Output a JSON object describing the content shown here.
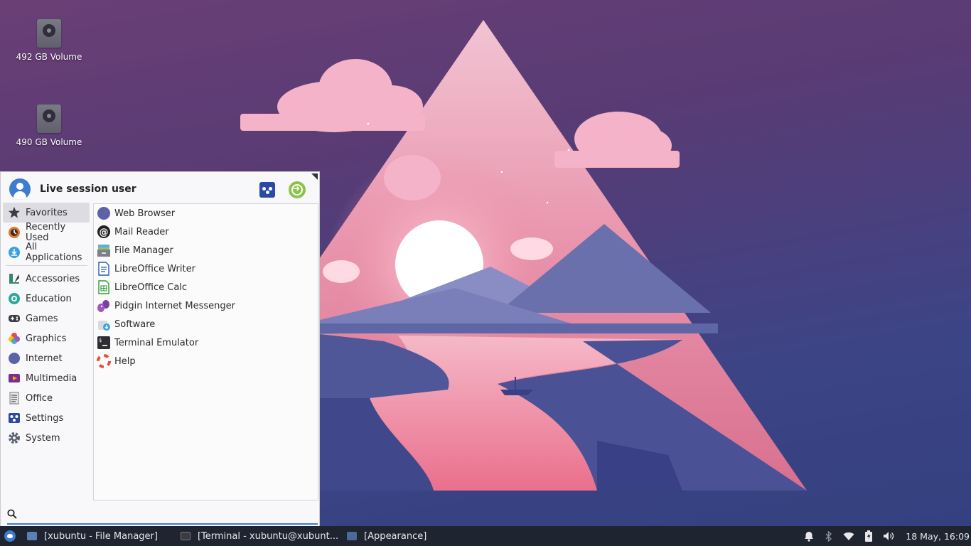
{
  "desktop": {
    "icons": [
      {
        "label": "492 GB Volume",
        "icon": "drive-icon"
      },
      {
        "label": "490 GB Volume",
        "icon": "drive-icon"
      }
    ]
  },
  "menu": {
    "user_name": "Live session user",
    "header_buttons": {
      "settings": "settings-icon",
      "logout": "logout-icon"
    },
    "categories": [
      {
        "label": "Favorites",
        "icon": "star-icon",
        "active": true
      },
      {
        "label": "Recently Used",
        "icon": "clock-icon"
      },
      {
        "label": "All Applications",
        "icon": "download-icon"
      },
      {
        "label": "Accessories",
        "icon": "accessories-icon"
      },
      {
        "label": "Education",
        "icon": "education-icon"
      },
      {
        "label": "Games",
        "icon": "gamepad-icon"
      },
      {
        "label": "Graphics",
        "icon": "graphics-icon"
      },
      {
        "label": "Internet",
        "icon": "globe-icon"
      },
      {
        "label": "Multimedia",
        "icon": "multimedia-icon"
      },
      {
        "label": "Office",
        "icon": "office-icon"
      },
      {
        "label": "Settings",
        "icon": "settings-icon"
      },
      {
        "label": "System",
        "icon": "gear-icon"
      }
    ],
    "apps": [
      {
        "label": "Web Browser",
        "icon": "compass-icon"
      },
      {
        "label": "Mail Reader",
        "icon": "at-icon"
      },
      {
        "label": "File Manager",
        "icon": "folder-icon"
      },
      {
        "label": "LibreOffice Writer",
        "icon": "writer-icon"
      },
      {
        "label": "LibreOffice Calc",
        "icon": "calc-icon"
      },
      {
        "label": "Pidgin Internet Messenger",
        "icon": "pidgin-icon"
      },
      {
        "label": "Software",
        "icon": "software-icon"
      },
      {
        "label": "Terminal Emulator",
        "icon": "terminal-icon"
      },
      {
        "label": "Help",
        "icon": "lifebuoy-icon"
      }
    ],
    "search": {
      "value": "",
      "placeholder": ""
    }
  },
  "taskbar": {
    "tasks": [
      {
        "label": "[xubuntu - File Manager]",
        "icon": "folder-icon"
      },
      {
        "label": "[Terminal - xubuntu@xubunt...",
        "icon": "terminal-icon"
      },
      {
        "label": "[Appearance]",
        "icon": "appearance-icon"
      }
    ],
    "clock": "18 May, 16:09"
  },
  "colors": {
    "accent": "#3d7ccf",
    "taskbar": "#1e2430",
    "menu_bg": "#f8f8fa"
  }
}
